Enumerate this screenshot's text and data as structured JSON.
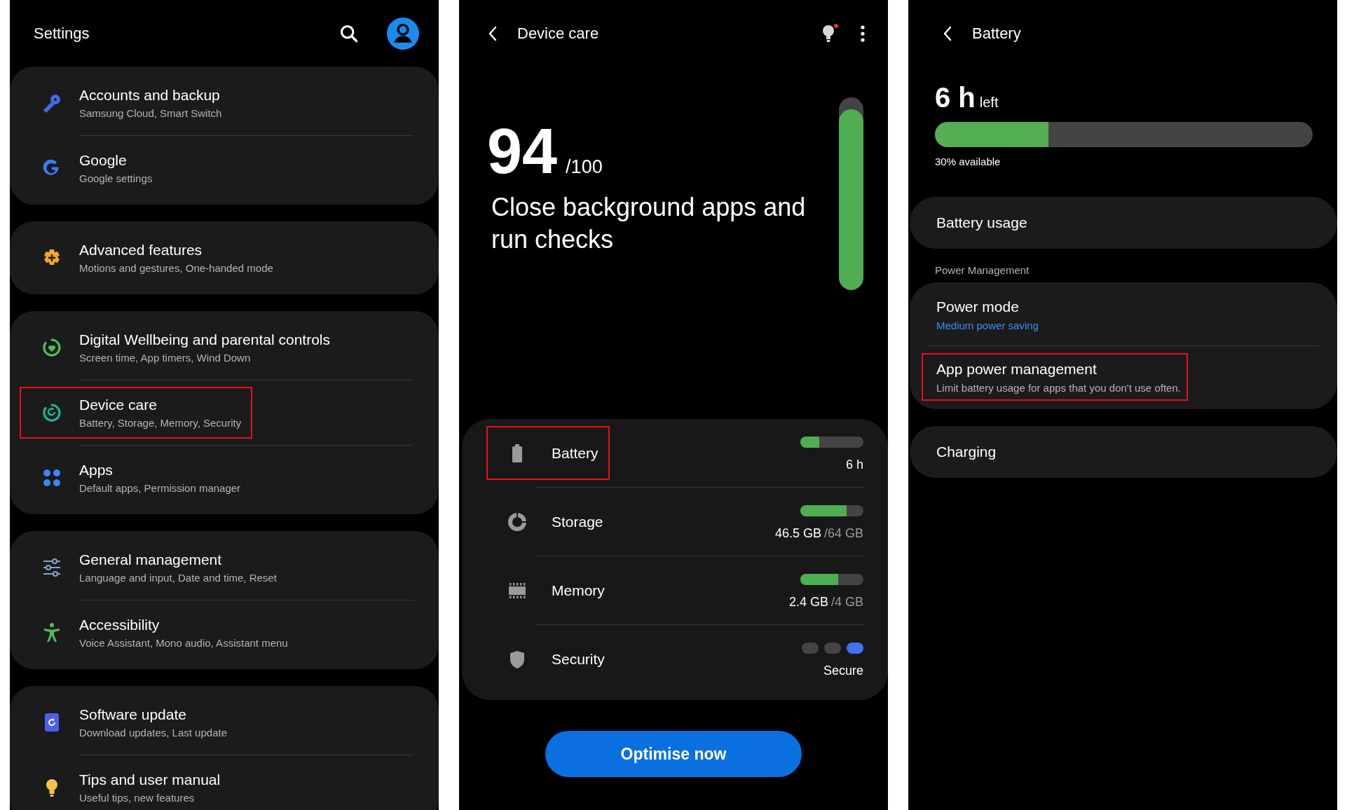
{
  "settings": {
    "title": "Settings",
    "groups": [
      {
        "items": [
          {
            "title": "Accounts and backup",
            "subtitle": "Samsung Cloud, Smart Switch",
            "highlighted": false
          },
          {
            "title": "Google",
            "subtitle": "Google settings",
            "highlighted": false
          }
        ]
      },
      {
        "items": [
          {
            "title": "Advanced features",
            "subtitle": "Motions and gestures, One-handed mode",
            "highlighted": false
          }
        ]
      },
      {
        "items": [
          {
            "title": "Digital Wellbeing and parental controls",
            "subtitle": "Screen time, App timers, Wind Down",
            "highlighted": false
          },
          {
            "title": "Device care",
            "subtitle": "Battery, Storage, Memory, Security",
            "highlighted": true
          },
          {
            "title": "Apps",
            "subtitle": "Default apps, Permission manager",
            "highlighted": false
          }
        ]
      },
      {
        "items": [
          {
            "title": "General management",
            "subtitle": "Language and input, Date and time, Reset",
            "highlighted": false
          },
          {
            "title": "Accessibility",
            "subtitle": "Voice Assistant, Mono audio, Assistant menu",
            "highlighted": false
          }
        ]
      },
      {
        "items": [
          {
            "title": "Software update",
            "subtitle": "Download updates, Last update",
            "highlighted": false
          },
          {
            "title": "Tips and user manual",
            "subtitle": "Useful tips, new features",
            "highlighted": false
          }
        ]
      }
    ]
  },
  "device_care": {
    "title": "Device care",
    "tips_badge": true,
    "score": "94",
    "score_max": "/100",
    "message": "Close background apps and run checks",
    "score_meter": {
      "level": 0.94
    },
    "items": [
      {
        "kind": "bar",
        "label": "Battery",
        "level": 0.3,
        "value": "6 h",
        "highlighted": true
      },
      {
        "kind": "bar",
        "label": "Storage",
        "level": 0.73,
        "value": "46.5 GB",
        "total": "/64 GB",
        "highlighted": false
      },
      {
        "kind": "bar",
        "label": "Memory",
        "level": 0.6,
        "value": "2.4 GB",
        "total": "/4 GB",
        "highlighted": false
      },
      {
        "kind": "dots",
        "label": "Security",
        "dots": [
          {
            "selected": false
          },
          {
            "selected": false
          },
          {
            "selected": true
          }
        ],
        "value": "Secure",
        "highlighted": false
      }
    ],
    "button": "Optimise now"
  },
  "battery": {
    "title": "Battery",
    "time": "6 h",
    "time_suffix": "left",
    "level": 0.3,
    "available": "30% available",
    "blocks": [
      {
        "kind": "card",
        "items": [
          {
            "title": "Battery usage",
            "highlighted": false
          }
        ]
      },
      {
        "kind": "header",
        "text": "Power Management"
      },
      {
        "kind": "card",
        "items": [
          {
            "title": "Power mode",
            "subtitle": "Medium power saving",
            "subtitle_accent": true,
            "highlighted": false
          },
          {
            "title": "App power management",
            "subtitle": "Limit battery usage for apps that you don't use often.",
            "subtitle_accent": false,
            "highlighted": true
          }
        ]
      },
      {
        "kind": "card",
        "items": [
          {
            "title": "Charging",
            "highlighted": false
          }
        ]
      }
    ]
  }
}
